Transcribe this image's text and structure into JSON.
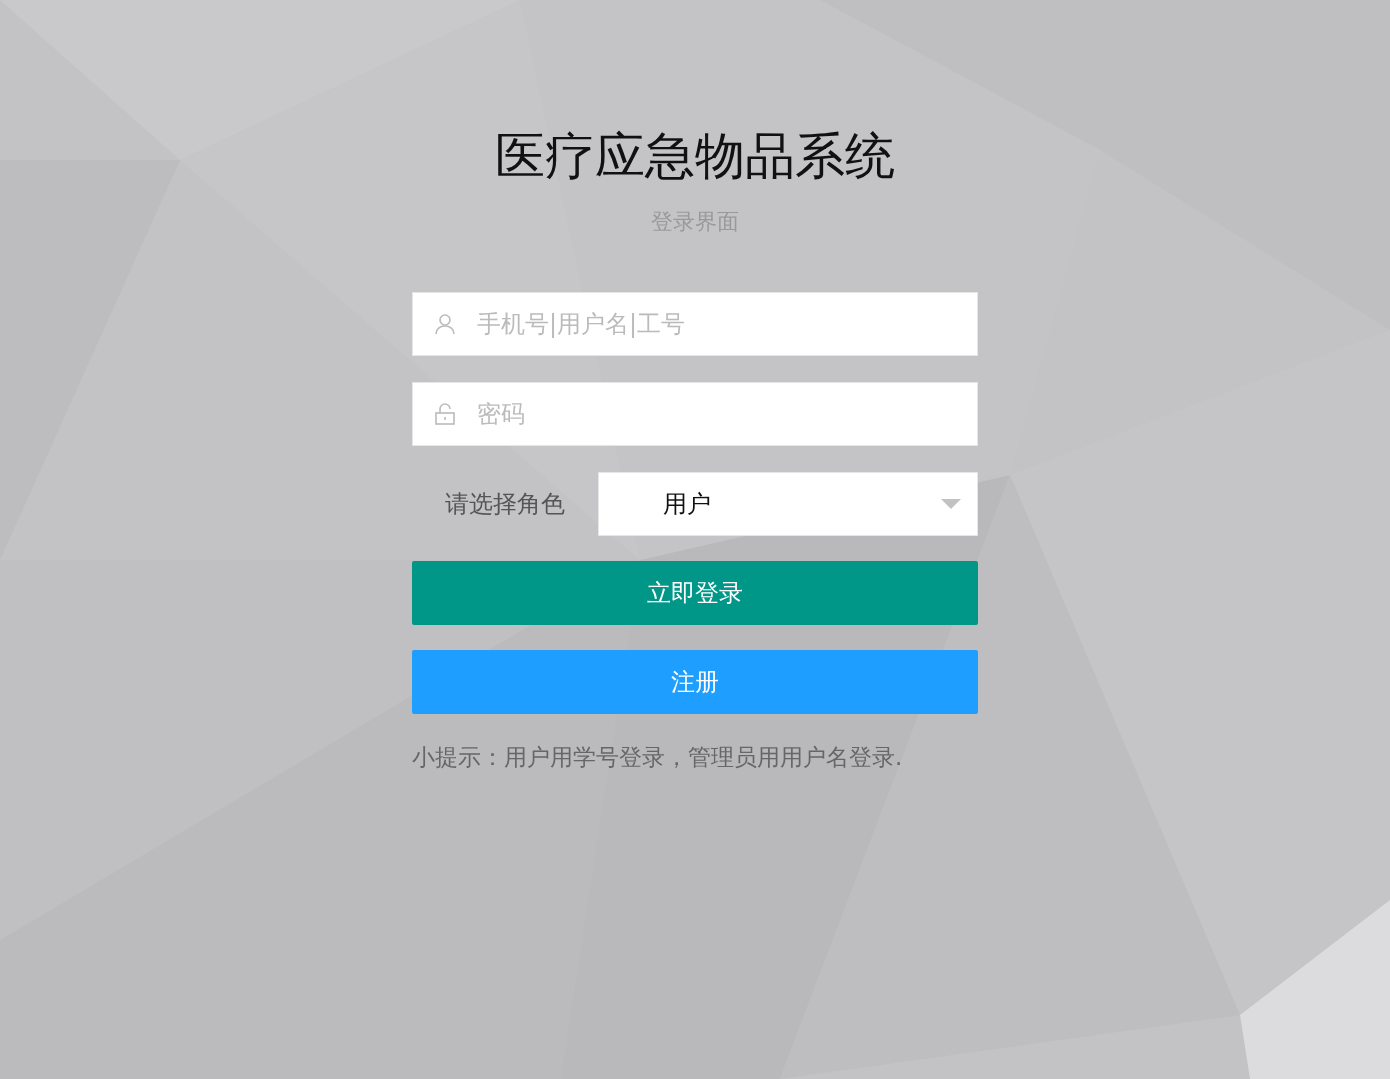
{
  "title": "医疗应急物品系统",
  "subtitle": "登录界面",
  "username": {
    "placeholder": "手机号|用户名|工号"
  },
  "password": {
    "placeholder": "密码"
  },
  "role": {
    "label": "请选择角色",
    "value": "用户"
  },
  "buttons": [
    {
      "label": "立即登录",
      "kind": "primary"
    },
    {
      "label": "注册",
      "kind": "secondary"
    }
  ],
  "tip": "小提示：用户用学号登录，管理员用用户名登录."
}
